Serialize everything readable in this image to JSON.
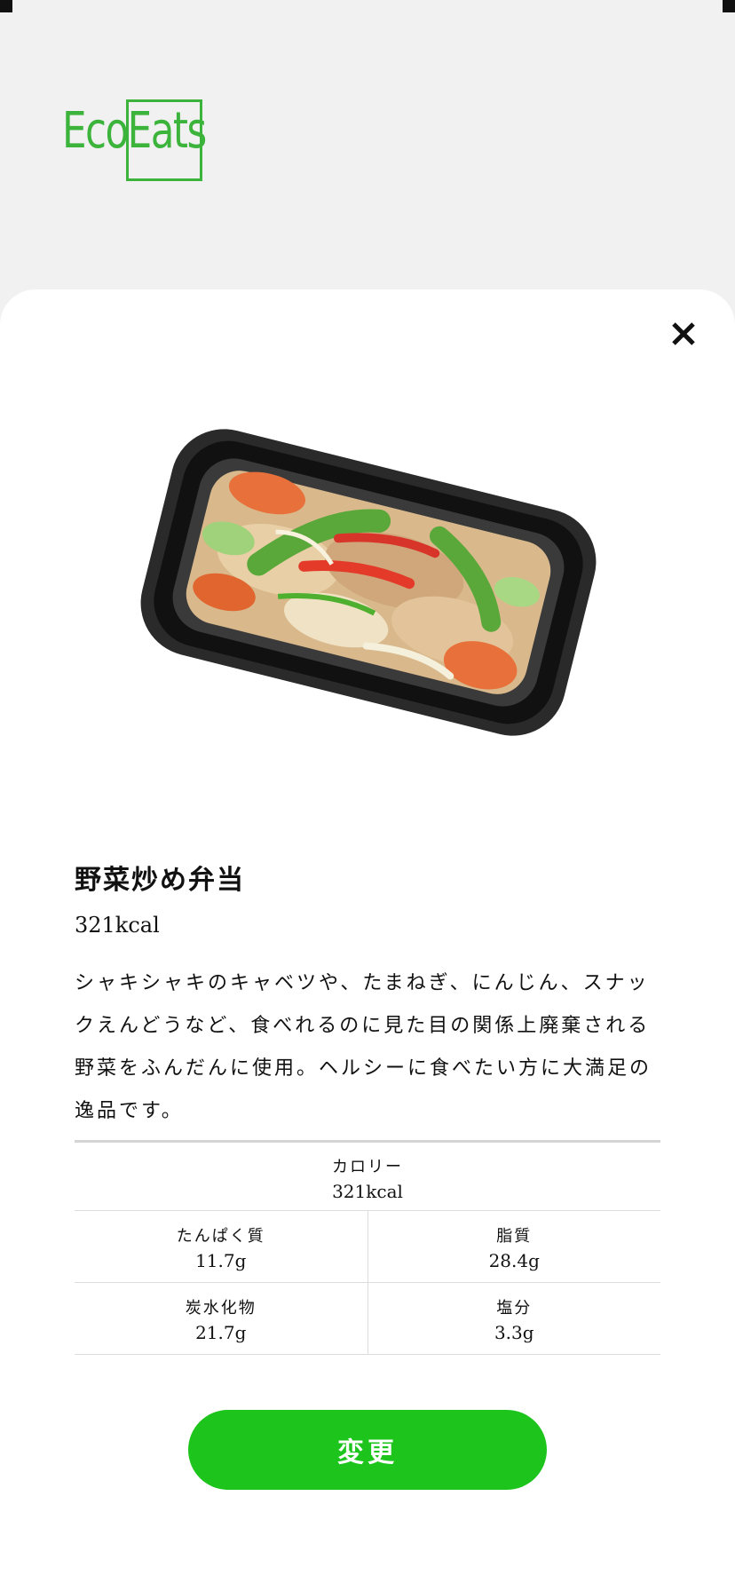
{
  "brand": {
    "logo_text": "EcoEats",
    "accent_color": "#3cb43c",
    "button_color": "#1cc41c"
  },
  "close_icon": "close-icon",
  "product": {
    "name": "野菜炒め弁当",
    "calories": "321kcal",
    "description": "シャキシャキのキャベツや、たまねぎ、にんじん、スナックえんどうなど、食べれるのに見た目の関係上廃棄される野菜をふんだんに使用。ヘルシーに食べたい方に大満足の逸品です。"
  },
  "nutrition": {
    "calorie": {
      "label": "カロリー",
      "value": "321kcal"
    },
    "protein": {
      "label": "たんぱく質",
      "value": "11.7g"
    },
    "fat": {
      "label": "脂質",
      "value": "28.4g"
    },
    "carbs": {
      "label": "炭水化物",
      "value": "21.7g"
    },
    "salt": {
      "label": "塩分",
      "value": "3.3g"
    }
  },
  "actions": {
    "change_label": "変更"
  }
}
